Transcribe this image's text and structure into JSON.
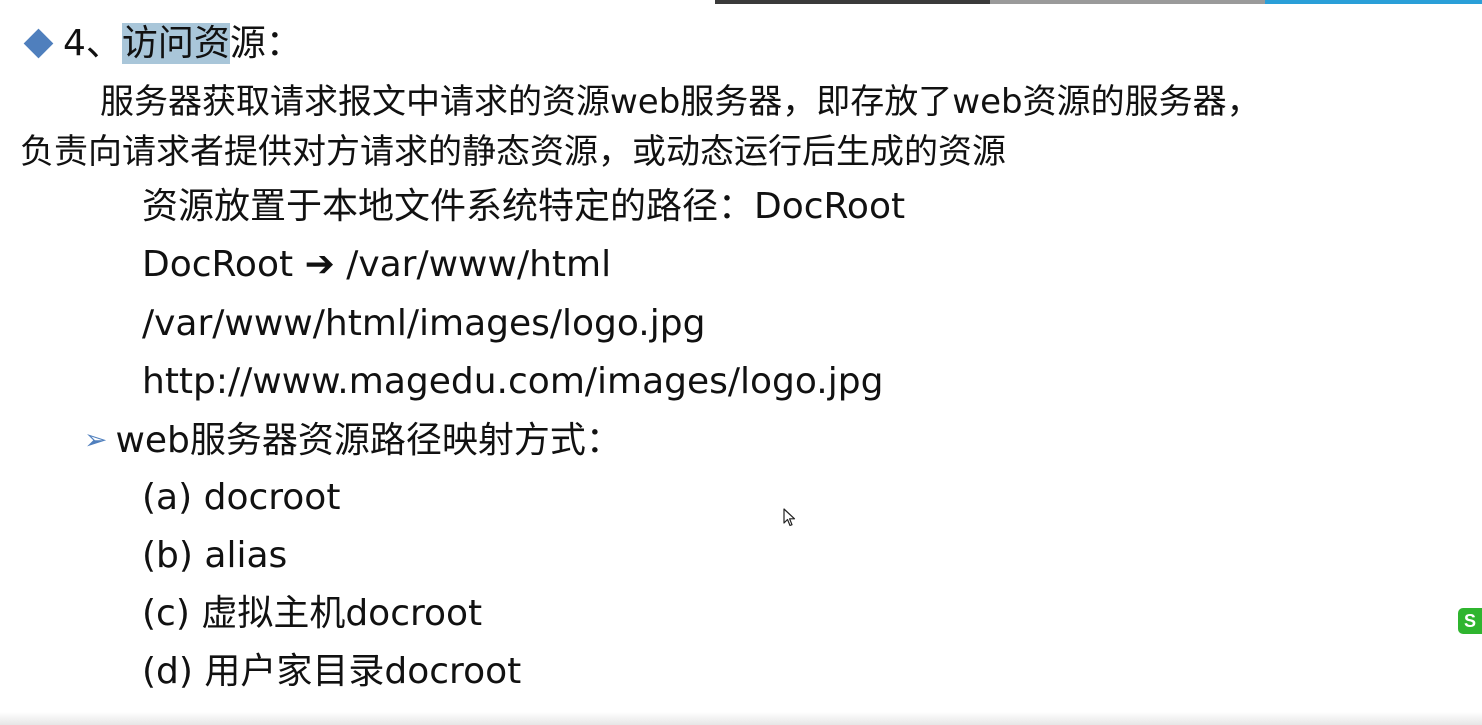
{
  "heading": {
    "number": "4、",
    "highlighted_text": "访问资",
    "rest_text": "源："
  },
  "paragraph": {
    "line1": "服务器获取请求报文中请求的资源web服务器，即存放了web资源的服务器，",
    "line2": "负责向请求者提供对方请求的静态资源，或动态运行后生成的资源"
  },
  "lines": {
    "docroot_desc": "资源放置于本地文件系统特定的路径：DocRoot",
    "docroot_map_left": "DocRoot",
    "docroot_map_arrow": "➔",
    "docroot_map_right": "/var/www/html",
    "file_path": "/var/www/html/images/logo.jpg",
    "url": "http://www.magedu.com/images/logo.jpg"
  },
  "subheading": {
    "marker": "➢",
    "text": "web服务器资源路径映射方式："
  },
  "options": [
    "(a) docroot",
    "(b) alias",
    "(c) 虚拟主机docroot",
    "(d) 用户家目录docroot"
  ],
  "side_badge": {
    "text": "S"
  },
  "colors": {
    "accent": "#4f7fbd",
    "highlight": "#a9c6d9",
    "text": "#111111",
    "badge": "#2fb52f"
  }
}
